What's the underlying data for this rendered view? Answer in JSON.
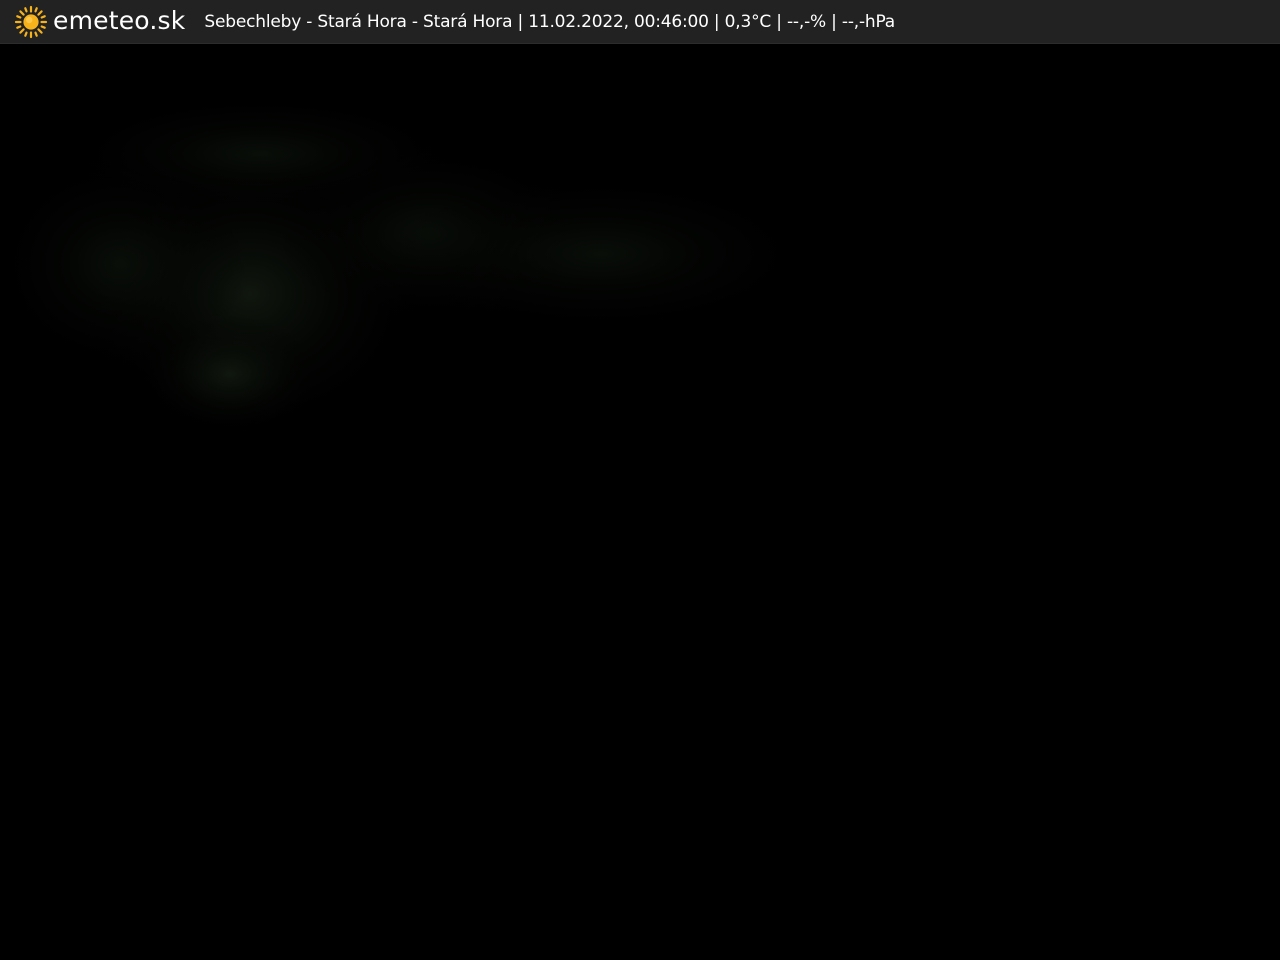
{
  "header": {
    "logo_icon": "sun-icon",
    "logo_text": "emeteo.sk",
    "station_info": "Sebechleby - Stará Hora - Stará Hora | 11.02.2022, 00:46:00 | 0,3°C | --,-% | --,-hPa"
  },
  "colors": {
    "header_background": "#222222",
    "sun_accent": "#f6b21b",
    "text": "#ffffff",
    "image_background": "#000000"
  }
}
